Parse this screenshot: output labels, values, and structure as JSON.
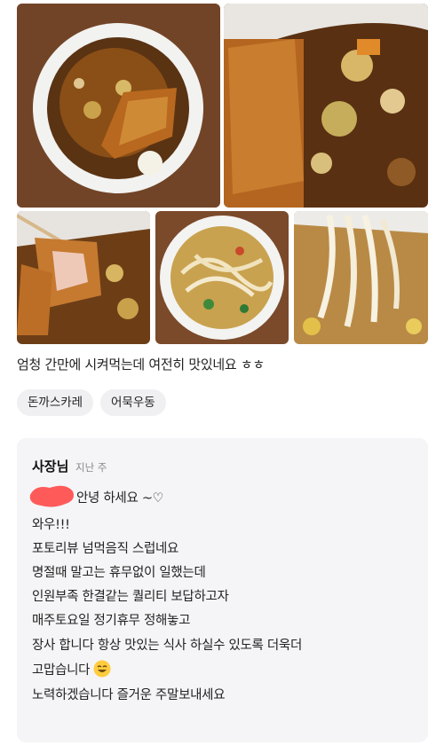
{
  "review": {
    "photos": [
      {
        "subject": "pork-cutlet-curry-top-view"
      },
      {
        "subject": "pork-cutlet-curry-closeup"
      },
      {
        "subject": "cutlet-piece-on-chopsticks"
      },
      {
        "subject": "fishcake-udon-top-view"
      },
      {
        "subject": "udon-noodles-lifted"
      }
    ],
    "text": "엄청 간만에 시켜먹는데 여전히 맛있네요 ㅎㅎ",
    "tags": [
      "돈까스카레",
      "어묵우동"
    ]
  },
  "reply": {
    "author": "사장님",
    "time": "지난 주",
    "greeting": "안녕 하세요 ~♡",
    "lines": [
      "와우!!!",
      "포토리뷰 넘먹음직 스럽네요",
      "명절때 말고는 휴무없이 일했는데",
      "인원부족 한결같는 퀄리티 보답하고자",
      "매주토요일 정기휴무 정해놓고",
      "장사 합니다  항상 맛있는 식사 하실수 있도록 더욱더",
      "고맙습니다",
      "노력하겠습니다  즐거운 주말보내세요"
    ],
    "emoji": "smiling-face-icon",
    "redaction_color": "#ff5a5a"
  },
  "colors": {
    "reply_bg": "#f5f5f7",
    "tag_bg": "#f0f0f3"
  }
}
